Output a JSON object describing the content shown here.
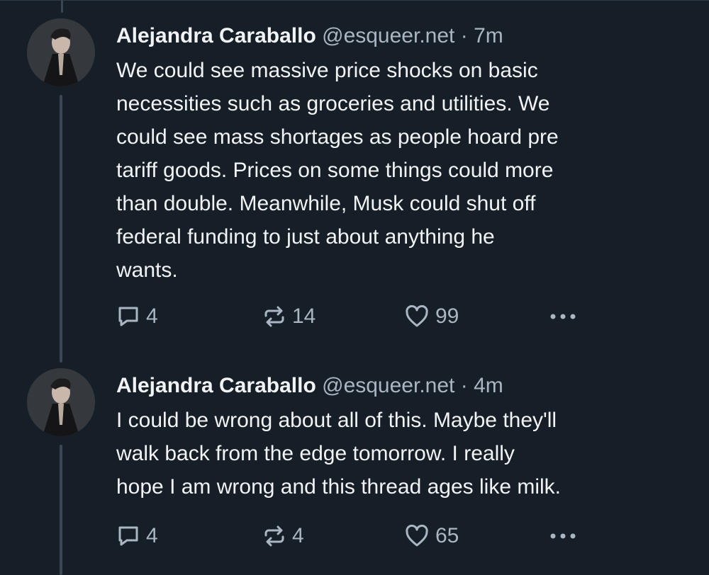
{
  "posts": [
    {
      "author_name": "Alejandra Caraballo",
      "handle": "@esqueer.net",
      "separator": "·",
      "time": "7m",
      "text": "We could see massive price shocks on basic\nnecessities such as groceries and utilities. We\ncould see mass shortages as people hoard pre\ntariff goods. Prices on some things could more\nthan double. Meanwhile, Musk could shut off\nfederal funding to just about anything he\nwants.",
      "replies": "4",
      "reposts": "14",
      "likes": "99"
    },
    {
      "author_name": "Alejandra Caraballo",
      "handle": "@esqueer.net",
      "separator": "·",
      "time": "4m",
      "text": "I could be wrong about all of this. Maybe they'll\nwalk back from the edge tomorrow. I really\nhope I am wrong and this thread ages like milk.",
      "replies": "4",
      "reposts": "4",
      "likes": "65"
    }
  ],
  "icons": {
    "reply": "reply-icon",
    "repost": "repost-icon",
    "like": "heart-icon",
    "more": "more-options-icon"
  },
  "colors": {
    "background": "#161e27",
    "text": "#f1f3f5",
    "muted": "#aab6c3",
    "thread_line": "#3a4756"
  }
}
